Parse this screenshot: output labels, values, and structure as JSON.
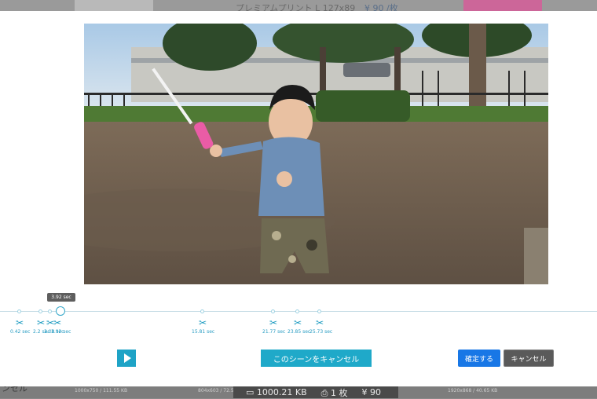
{
  "background": {
    "top_label": "プレミアムプリント L 127x89",
    "top_price": "¥ 90 /枚",
    "left_fragment": "ンセル",
    "captions": [
      "1000x750 / 111.55 KB",
      "804x603 / 72.52 KB",
      "1920x868 / 40.65 KB"
    ],
    "summary_size": "1000.21 KB",
    "summary_count": "1 枚",
    "summary_price": "¥ 90"
  },
  "timeline": {
    "current_time": "3.92 sec",
    "markers": [
      {
        "label": "0.42 sec"
      },
      {
        "label": "2.2 sec"
      },
      {
        "label": "3.08 sec"
      },
      {
        "label": "3.92 sec"
      },
      {
        "label": "15.81 sec"
      },
      {
        "label": "21.77 sec"
      },
      {
        "label": "23.85 sec"
      },
      {
        "label": "25.73 sec"
      }
    ]
  },
  "buttons": {
    "play": "play",
    "cancel_scene": "このシーンをキャンセル",
    "confirm": "確定する",
    "cancel": "キャンセル"
  },
  "icons": {
    "scissors": "scissors-icon",
    "play": "play-icon",
    "disk": "disk-icon",
    "printer": "printer-icon"
  },
  "colors": {
    "accent": "#1ea3c6",
    "confirm": "#1877e6",
    "cancel": "#5a5a5a"
  }
}
